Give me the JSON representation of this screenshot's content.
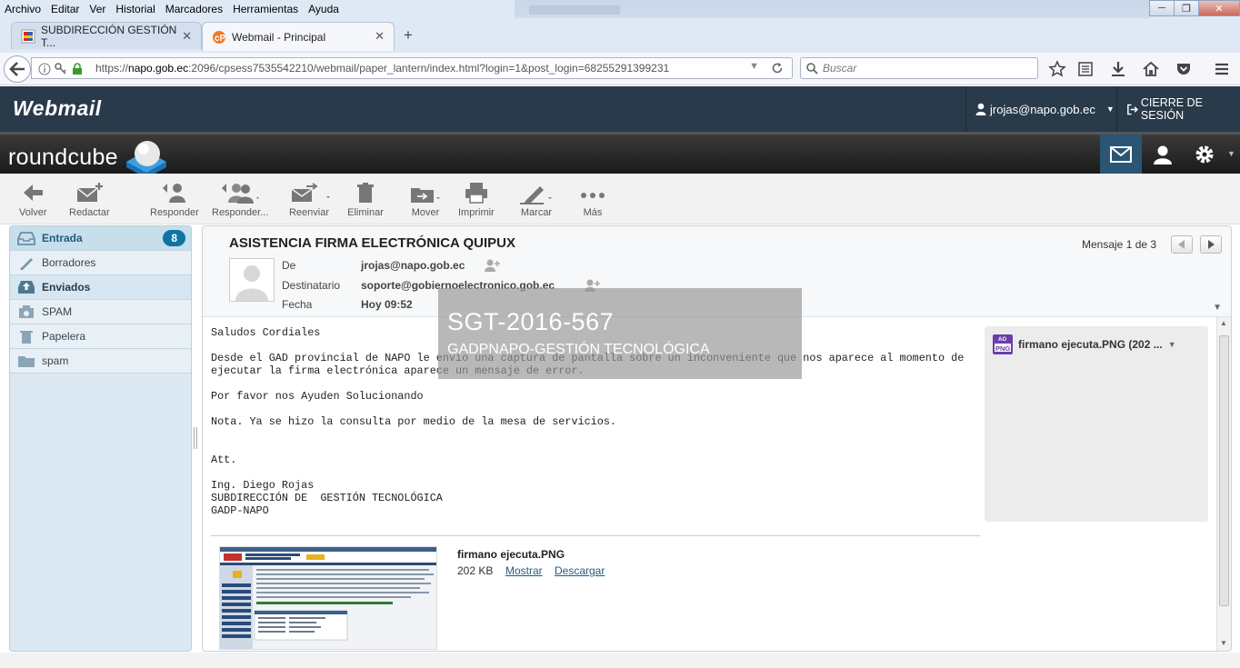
{
  "menubar": {
    "items": [
      "Archivo",
      "Editar",
      "Ver",
      "Historial",
      "Marcadores",
      "Herramientas",
      "Ayuda"
    ]
  },
  "tabs": [
    {
      "label": "SUBDIRECCIÓN GESTIÓN T...",
      "active": false
    },
    {
      "label": "Webmail - Principal",
      "active": true
    }
  ],
  "address_bar": {
    "url_prefix": "https://",
    "url_host": "napo.gob.ec",
    "url_rest": ":2096/cpsess7535542210/webmail/paper_lantern/index.html?login=1&post_login=68255291399231"
  },
  "search": {
    "placeholder": "Buscar"
  },
  "cpanel": {
    "logo": "Webmail",
    "user": "jrojas@napo.gob.ec",
    "logout": "CIERRE DE SESIÓN"
  },
  "roundcube": {
    "logo": "roundcube"
  },
  "toolbar": {
    "back": "Volver",
    "compose": "Redactar",
    "reply": "Responder",
    "reply_all": "Responder...",
    "forward": "Reenviar",
    "delete": "Eliminar",
    "move": "Mover",
    "print": "Imprimir",
    "mark": "Marcar",
    "more": "Más"
  },
  "folders": [
    {
      "name": "Entrada",
      "count": "8"
    },
    {
      "name": "Borradores"
    },
    {
      "name": "Enviados"
    },
    {
      "name": "SPAM"
    },
    {
      "name": "Papelera"
    },
    {
      "name": "spam"
    }
  ],
  "message": {
    "subject": "ASISTENCIA FIRMA ELECTRÓNICA QUIPUX",
    "counter": "Mensaje 1 de 3",
    "from_label": "De",
    "from": "jrojas@napo.gob.ec",
    "to_label": "Destinatario",
    "to": "soporte@gobiernoelectronico.gob.ec",
    "date_label": "Fecha",
    "date": "Hoy 09:52",
    "body": "Saludos Cordiales\n\nDesde el GAD provincial de NAPO le envío una captura de pantalla sobre un inconveniente que nos aparece al momento de\nejecutar la firma electrónica aparece un mensaje de error.\n\nPor favor nos Ayuden Solucionando\n\nNota. Ya se hizo la consulta por medio de la mesa de servicios.\n\n\nAtt.\n\nIng. Diego Rojas\nSUBDIRECCIÓN DE  GESTIÓN TECNOLÓGICA\nGADP-NAPO"
  },
  "attachment": {
    "filename": "firmano ejecuta.PNG",
    "size": "202 KB",
    "show": "Mostrar",
    "download": "Descargar",
    "panel_label": "firmano ejecuta.PNG (202 ...",
    "thumb_caption": "GOBIERNO AUTÓNOMO DESCENTRALIZADO PROVINCIAL DE NAPO"
  },
  "watermark": {
    "line1": "SGT-2016-567",
    "line2": "GADPNAPO-GESTIÓN TECNOLÓGICA"
  },
  "colors": {
    "cpanel_header": "#293a4a",
    "accent": "#1f5c80",
    "badge": "#0f73a6",
    "sidebar": "#dde9f2"
  }
}
